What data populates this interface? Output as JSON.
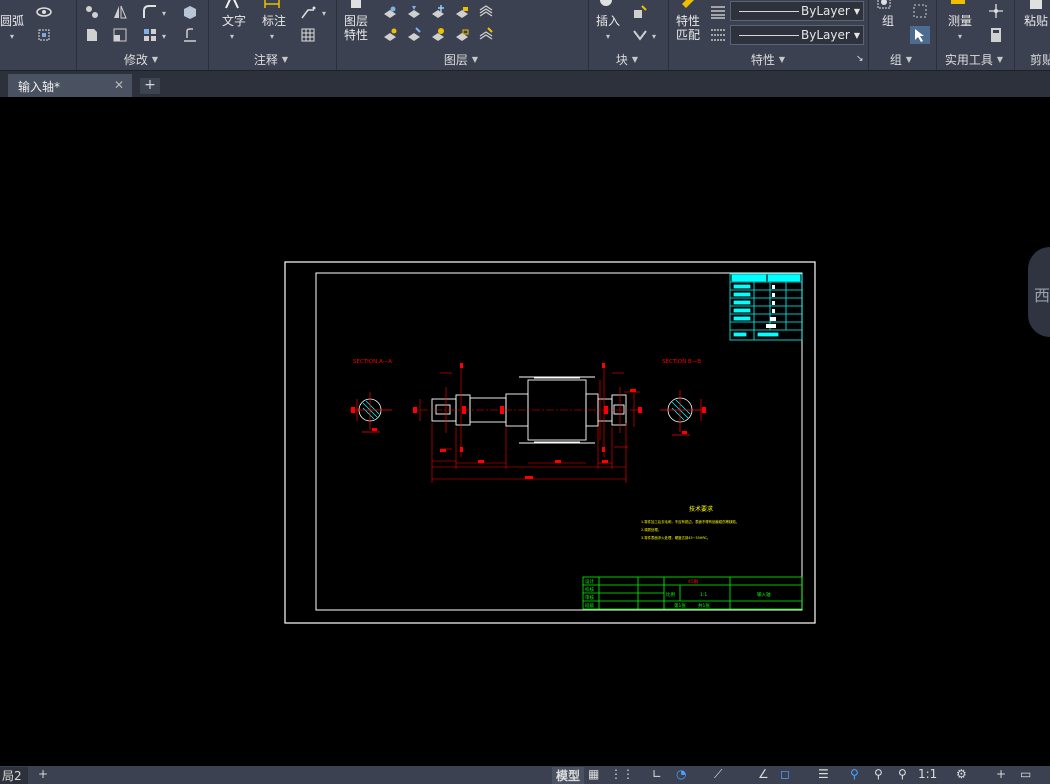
{
  "ribbon": {
    "draw_arc_label": "圆弧",
    "text_label": "文字",
    "dimension_label": "标注",
    "layer_props_label_1": "图层",
    "layer_props_label_2": "特性",
    "insert_label": "插入",
    "match_props_label_1": "特性",
    "match_props_label_2": "匹配",
    "group_label": "组",
    "measure_label": "测量",
    "paste_label": "粘贴",
    "linetype_value": "ByLayer",
    "lineweight_value": "ByLayer",
    "panels": {
      "modify": "修改",
      "annotation": "注释",
      "layers": "图层",
      "block": "块",
      "properties": "特性",
      "groups": "组",
      "utilities": "实用工具",
      "clipboard": "剪贴"
    }
  },
  "tabs": {
    "document": "输入轴*",
    "close": "✕",
    "add": "+"
  },
  "drawing": {
    "section_a": "SECTION A—A",
    "section_b": "SECTION B—B",
    "tech_req_title": "技术要求",
    "tech_req_lines": [
      "1.零件加工后去毛刺，不应有锐边，表面不得有划痕碰伤等缺陷。",
      "2.调质处理。",
      "3.零件表面淬火处理，硬度达到45~55HRC。"
    ],
    "title_block": {
      "material": "45钢",
      "scale_label": "比例",
      "scale": "1:1",
      "part_name": "输入轴",
      "sheet_1": "第1张",
      "sheet_total": "共1张",
      "rows": [
        "设计",
        "校核",
        "审核",
        "班级"
      ]
    }
  },
  "viewcube": {
    "label": "西"
  },
  "status": {
    "layout_tab": "局2",
    "add": "+",
    "model": "模型",
    "scale": "1:1"
  },
  "colors": {
    "ribbon_bg": "#3b4150",
    "canvas_bg": "#000000",
    "cad_red": "#ff0000",
    "cad_yellow": "#ffff00",
    "cad_cyan": "#00ffff",
    "cad_green": "#00ff00"
  }
}
